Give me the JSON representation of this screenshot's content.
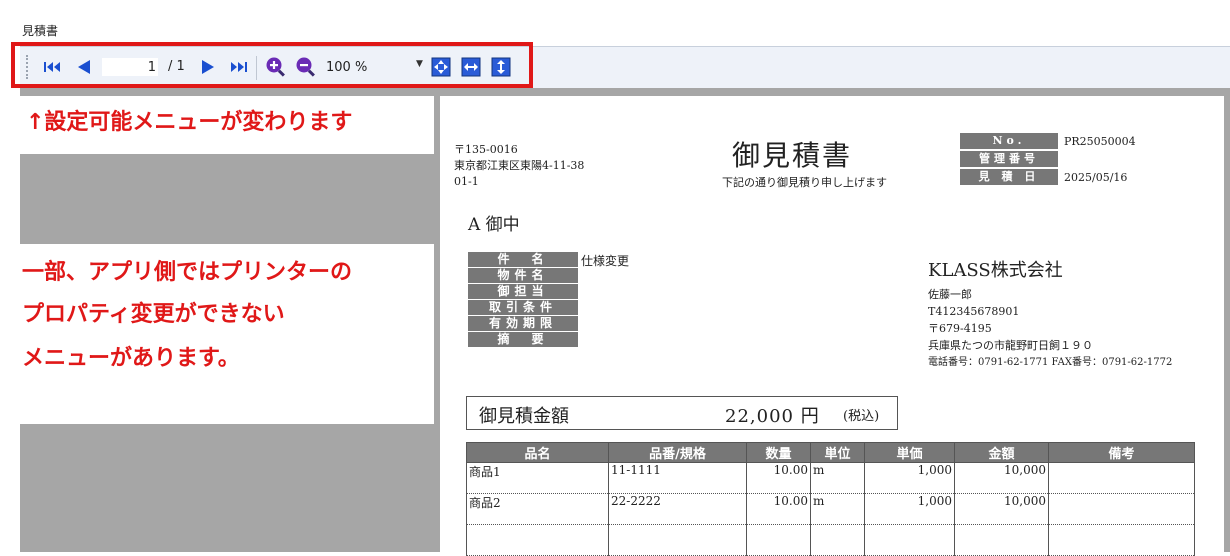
{
  "window_title": "見積書",
  "toolbar": {
    "page_current": "1",
    "page_total": "/ 1",
    "zoom": "100 %"
  },
  "notes": {
    "menu": "↑設定可能メニューが変わります",
    "printer_lines": [
      "一部、アプリ側ではプリンターの",
      "プロパティ変更ができない",
      "メニューがあります。"
    ]
  },
  "document": {
    "sender_lines": [
      "〒135-0016",
      "東京都江東区東陽4-11-38",
      "01-1"
    ],
    "title": "御見積書",
    "subtitle": "下記の通り御見積り申し上げます",
    "meta": [
      {
        "label": "No.",
        "value": "PR25050004"
      },
      {
        "label": "管理番号",
        "value": ""
      },
      {
        "label": "見 積 日",
        "value": "2025/05/16"
      }
    ],
    "addressee": "A 御中",
    "info": [
      {
        "label": "件　名",
        "value": "仕様変更"
      },
      {
        "label": "物件名",
        "value": ""
      },
      {
        "label": "御担当",
        "value": ""
      },
      {
        "label": "取引条件",
        "value": ""
      },
      {
        "label": "有効期限",
        "value": ""
      },
      {
        "label": "摘　要",
        "value": ""
      }
    ],
    "company": {
      "name": "KLASS株式会社",
      "lines": [
        "佐藤一郎",
        "T412345678901",
        "〒679-4195",
        "兵庫県たつの市龍野町日飼１９０",
        "電話番号：0791-62-1771 FAX番号：0791-62-1772"
      ]
    },
    "amount": {
      "label": "御見積金額",
      "value": "22,000 円",
      "tax": "(税込)"
    },
    "items": {
      "headers": [
        "品名",
        "品番/規格",
        "数量",
        "単位",
        "単価",
        "金額",
        "備考"
      ],
      "rows": [
        [
          "商品1",
          "11-1111",
          "10.00",
          "m",
          "1,000",
          "10,000",
          ""
        ],
        [
          "商品2",
          "22-2222",
          "10.00",
          "m",
          "1,000",
          "10,000",
          ""
        ],
        [
          "",
          "",
          "",
          "",
          "",
          "",
          ""
        ]
      ]
    }
  },
  "colors": {
    "accent_red": "#e01818",
    "toolbar_icon_blue": "#1a4fd0",
    "zoom_icon_purple": "#6a2bb5"
  }
}
